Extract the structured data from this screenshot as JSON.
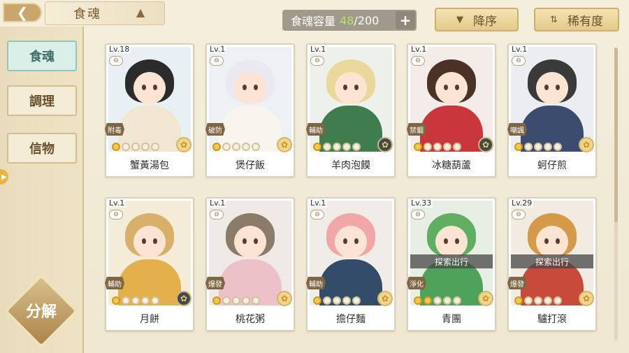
{
  "header": {
    "back_icon": "back-arrow-icon",
    "title": "食魂",
    "emblem_icon": "hat-emblem-icon",
    "capacity_label": "食魂容量",
    "capacity_current": "48",
    "capacity_max": "/200",
    "capacity_plus": "+",
    "sort_order_label": "降序",
    "sort_rarity_label": "稀有度"
  },
  "sidebar": {
    "tabs": [
      {
        "label": "食魂",
        "active": true
      },
      {
        "label": "調理",
        "active": false
      },
      {
        "label": "信物",
        "active": false
      }
    ],
    "decompose_label": "分解"
  },
  "cards": [
    {
      "level": "Lv.18",
      "role": "附毒",
      "name": "蟹黃湯包",
      "stars": 1,
      "gem": "gold",
      "hair": "#2b2b2b",
      "cloth": "#f1e6d2",
      "bg": "#e9f0f4",
      "explore": ""
    },
    {
      "level": "Lv.1",
      "role": "破防",
      "name": "煲仔飯",
      "stars": 1,
      "gem": "gold",
      "hair": "#e9e9ef",
      "cloth": "#f7f5ee",
      "bg": "#eef1f4",
      "explore": ""
    },
    {
      "level": "Lv.1",
      "role": "輔助",
      "name": "羊肉泡饃",
      "stars": 1,
      "gem": "dark",
      "hair": "#e8d89a",
      "cloth": "#3f7d4e",
      "bg": "#eef0ec",
      "explore": ""
    },
    {
      "level": "Lv.1",
      "role": "禁錮",
      "name": "冰糖葫蘆",
      "stars": 1,
      "gem": "dark",
      "hair": "#4a3326",
      "cloth": "#c9373c",
      "bg": "#f3ece8",
      "explore": ""
    },
    {
      "level": "Lv.1",
      "role": "嘲諷",
      "name": "蚵仔煎",
      "stars": 1,
      "gem": "gold",
      "hair": "#3a3a3a",
      "cloth": "#3b4c6e",
      "bg": "#ecedf0",
      "explore": ""
    },
    {
      "level": "Lv.1",
      "role": "輔助",
      "name": "月餅",
      "stars": 1,
      "gem": "dark",
      "hair": "#d8b06a",
      "cloth": "#e3b04c",
      "bg": "#f4ecd8",
      "explore": ""
    },
    {
      "level": "Lv.1",
      "role": "爆發",
      "name": "桃花粥",
      "stars": 1,
      "gem": "gold",
      "hair": "#8b7b6a",
      "cloth": "#ecc1c8",
      "bg": "#efeae6",
      "explore": ""
    },
    {
      "level": "Lv.1",
      "role": "輔助",
      "name": "擔仔麵",
      "stars": 1,
      "gem": "gold",
      "hair": "#f2a7a7",
      "cloth": "#324c6a",
      "bg": "#f0ece8",
      "explore": ""
    },
    {
      "level": "Lv.33",
      "role": "淨化",
      "name": "青團",
      "stars": 2,
      "gem": "gold",
      "hair": "#5fae62",
      "cloth": "#4ea25a",
      "bg": "#e7efe4",
      "explore": "探索出行"
    },
    {
      "level": "Lv.29",
      "role": "爆發",
      "name": "驢打滾",
      "stars": 1,
      "gem": "gold",
      "hair": "#d49a4a",
      "cloth": "#c84a3a",
      "bg": "#f1ebe2",
      "explore": "探索出行"
    }
  ]
}
